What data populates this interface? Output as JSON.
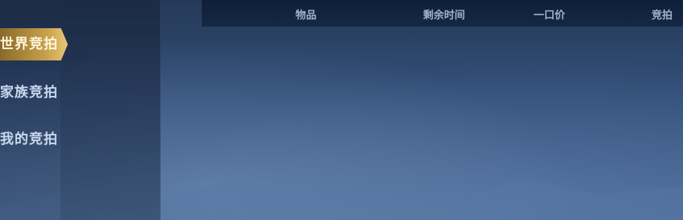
{
  "sidebar": {
    "tabs": [
      {
        "label": "世界竞拍",
        "active": true
      },
      {
        "label": "家族竞拍",
        "active": false
      },
      {
        "label": "我的竞拍",
        "active": false
      }
    ]
  },
  "table": {
    "columns": [
      "物品",
      "剩余时间",
      "一口价",
      "竞拍"
    ]
  },
  "colors": {
    "active_tab": "#c9a24c",
    "background": "#33507a",
    "header_bar": "#0f1f38"
  }
}
